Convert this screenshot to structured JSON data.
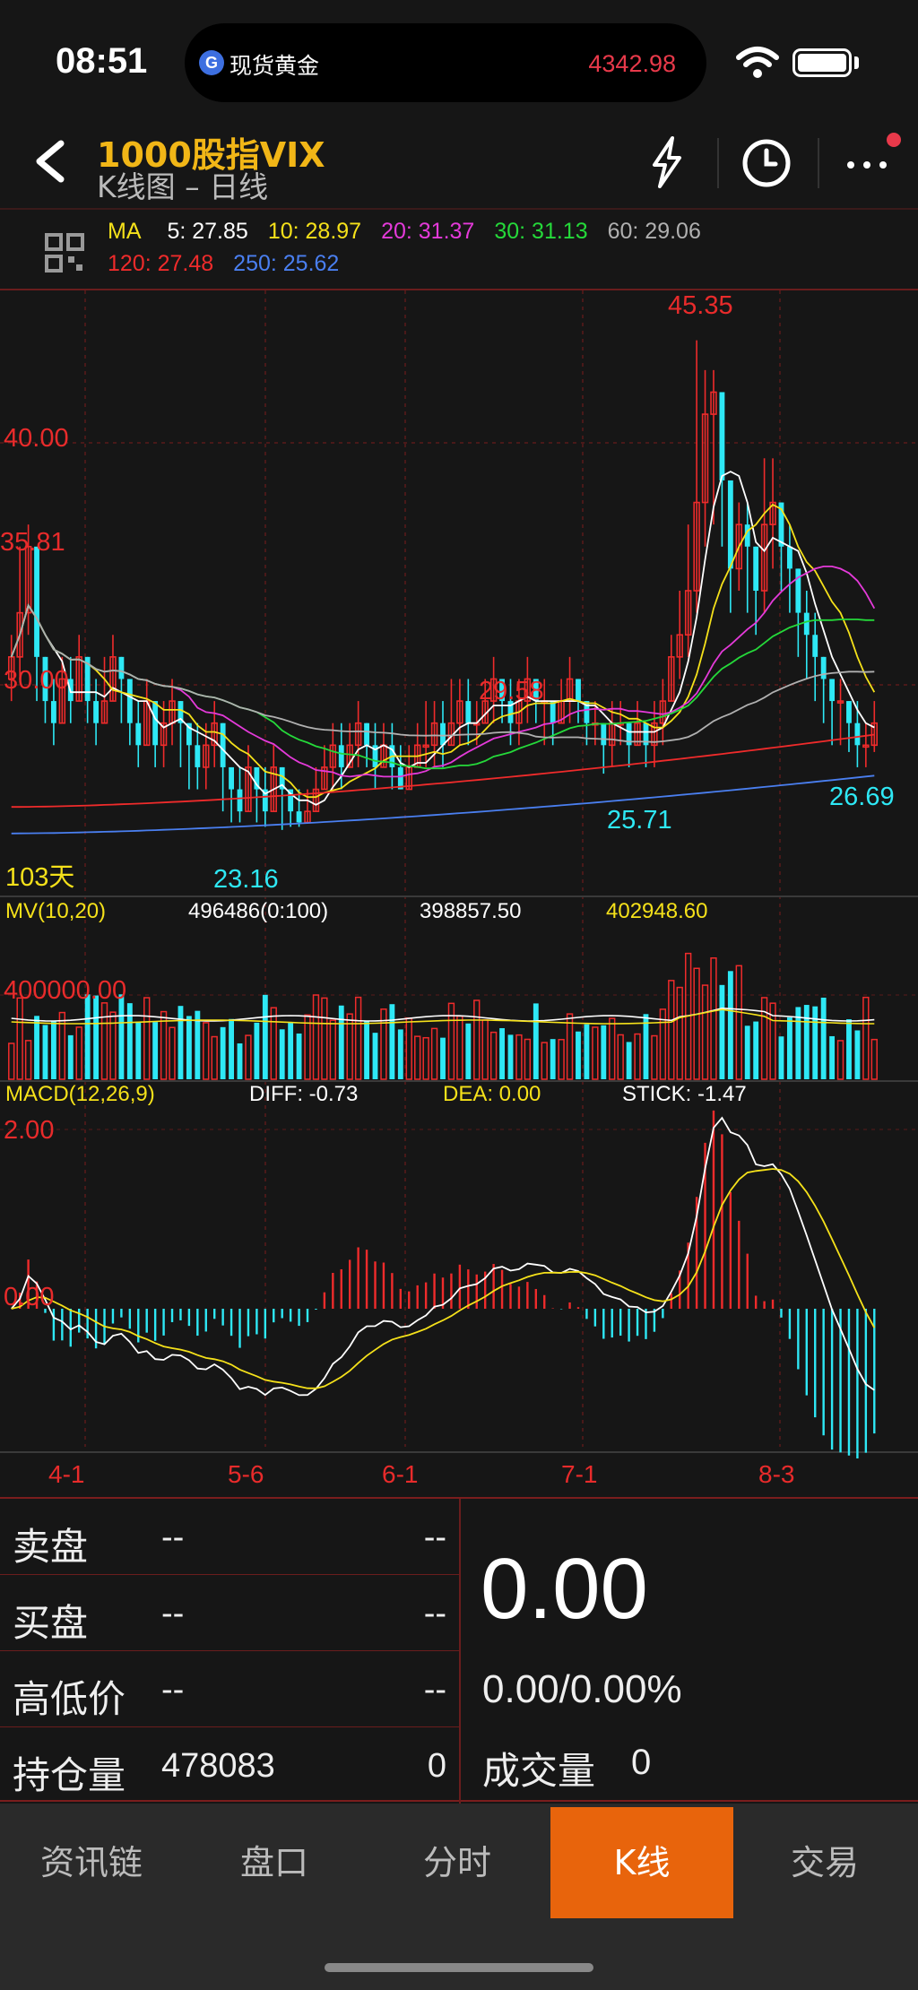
{
  "status": {
    "time": "08:51",
    "ticker_name": "现货黄金",
    "ticker_price": "4342.98",
    "ticker_icon": "G"
  },
  "header": {
    "title": "1000股指VIX",
    "subtitle": "K线图 – 日线"
  },
  "ma": {
    "label": "MA",
    "items": [
      {
        "text": "5: 27.85",
        "color": "#ffffff"
      },
      {
        "text": "10: 28.97",
        "color": "#f5e11a"
      },
      {
        "text": "20: 31.37",
        "color": "#e43ad9"
      },
      {
        "text": "30: 31.13",
        "color": "#25d93a"
      },
      {
        "text": "60: 29.06",
        "color": "#b0b0b0"
      }
    ],
    "items2": [
      {
        "text": "120: 27.48",
        "color": "#ef2b2b"
      },
      {
        "text": "250: 25.62",
        "color": "#4a7ff0"
      }
    ]
  },
  "price_panel": {
    "labels": {
      "y40": "40.00",
      "y35": "35.81",
      "y30": "30.00",
      "high": "45.35",
      "peak2": "29.58",
      "low1": "23.16",
      "low2": "25.71",
      "last": "26.69",
      "days": "103天"
    }
  },
  "volume_panel": {
    "title": "MV(10,20)",
    "v1": "496486(0:100)",
    "v2": "398857.50",
    "v3": "402948.60",
    "axis": "400000.00"
  },
  "macd_panel": {
    "title": "MACD(12,26,9)",
    "diff": "DIFF: -0.73",
    "dea": "DEA: 0.00",
    "stick": "STICK: -1.47",
    "axis_top": "2.00",
    "axis_zero": "0.00"
  },
  "x_axis": [
    "4-1",
    "5-6",
    "6-1",
    "7-1",
    "8-3"
  ],
  "chart_data": {
    "type": "candlestick",
    "x_ticks": [
      "4-1",
      "5-6",
      "6-1",
      "7-1",
      "8-3"
    ],
    "close": [
      31,
      33,
      36,
      31,
      29,
      28,
      30,
      29,
      31,
      29,
      28,
      29,
      31,
      30,
      28,
      27,
      29,
      27,
      28,
      29,
      28,
      27,
      26,
      27,
      28,
      26,
      25,
      24,
      26,
      25,
      24,
      26,
      25,
      24,
      23.5,
      24,
      25,
      26,
      27,
      26,
      27,
      28,
      27,
      26,
      27,
      26,
      25,
      26,
      27,
      27,
      28,
      27,
      28,
      29,
      28,
      28,
      29,
      30,
      29,
      28,
      29,
      30,
      29,
      29,
      28,
      29,
      30,
      29,
      28,
      28,
      27,
      28,
      28,
      27,
      28,
      27,
      28,
      29,
      31,
      32,
      34,
      38,
      42,
      43,
      39,
      35,
      37,
      36,
      34,
      37,
      38,
      36,
      35,
      33,
      32,
      31,
      30,
      29,
      29,
      28,
      27,
      27,
      28
    ],
    "high": [
      32,
      36,
      37,
      33,
      31,
      30,
      31,
      31,
      32,
      31,
      30,
      31,
      32,
      31,
      30,
      29,
      30,
      29,
      29,
      30,
      29,
      28,
      28,
      28,
      29,
      28,
      26,
      26,
      27,
      26,
      26,
      27,
      26,
      25,
      25,
      25,
      26,
      27,
      28,
      28,
      28,
      29,
      28,
      28,
      28,
      28,
      27,
      27,
      28,
      29,
      29,
      29,
      30,
      30,
      30,
      29,
      30,
      31,
      30,
      30,
      30,
      31,
      30,
      30,
      29,
      30,
      31,
      30,
      29,
      29,
      28,
      29,
      29,
      28,
      29,
      28,
      29,
      30,
      32,
      34,
      37,
      45.35,
      44,
      44,
      41,
      37,
      38,
      38,
      36,
      40,
      40,
      38,
      37,
      35,
      34,
      33,
      31,
      30,
      30,
      29,
      29,
      28,
      29
    ],
    "low": [
      29,
      30,
      32,
      29,
      28,
      27,
      28,
      28,
      29,
      28,
      27,
      28,
      29,
      28,
      27,
      26,
      27,
      26,
      26,
      27,
      26,
      25,
      25,
      25,
      26,
      24,
      23.5,
      23.5,
      24,
      23.5,
      23.3,
      24,
      23.16,
      23.3,
      23.3,
      23.5,
      24,
      25,
      25,
      25,
      26,
      26,
      26,
      25,
      26,
      25,
      25,
      25,
      26,
      26,
      26,
      26,
      27,
      27,
      27,
      27,
      28,
      28,
      28,
      27,
      27,
      28,
      28,
      27,
      27,
      28,
      28,
      28,
      27,
      27,
      25.71,
      26,
      27,
      26,
      27,
      26,
      26,
      27,
      29,
      30,
      31,
      33,
      36,
      37,
      36,
      33,
      34,
      33,
      32,
      33,
      35,
      34,
      33,
      31,
      30,
      29,
      28,
      27,
      27,
      26.69,
      26,
      26,
      26.69
    ],
    "ma": {
      "5": 27.85,
      "10": 28.97,
      "20": 31.37,
      "30": 31.13,
      "60": 29.06,
      "120": 27.48,
      "250": 25.62
    },
    "price_range": [
      21,
      47
    ],
    "macd": {
      "diff": -0.73,
      "dea": 0.0,
      "stick": -1.47,
      "range": [
        -2.2,
        2.2
      ]
    },
    "volume_axis": 400000
  }
}
